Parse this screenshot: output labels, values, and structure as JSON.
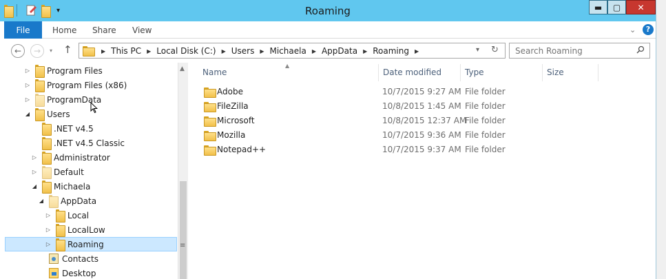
{
  "window": {
    "title": "Roaming",
    "minimize": "▬",
    "maximize": "▢",
    "close": "✕"
  },
  "ribbon": {
    "file": "File",
    "home": "Home",
    "share": "Share",
    "view": "View",
    "help": "?"
  },
  "nav": {
    "back": "←",
    "forward": "→",
    "up": "↑",
    "breadcrumbs": [
      "This PC",
      "Local Disk (C:)",
      "Users",
      "Michaela",
      "AppData",
      "Roaming"
    ],
    "search_placeholder": "Search Roaming"
  },
  "tree": [
    {
      "label": "Program Files",
      "toggle": "▷"
    },
    {
      "label": "Program Files (x86)",
      "toggle": "▷"
    },
    {
      "label": "ProgramData",
      "toggle": "▷"
    },
    {
      "label": "Users",
      "toggle": "◢"
    },
    {
      "label": ".NET v4.5",
      "toggle": ""
    },
    {
      "label": ".NET v4.5 Classic",
      "toggle": ""
    },
    {
      "label": "Administrator",
      "toggle": "▷"
    },
    {
      "label": "Default",
      "toggle": "▷"
    },
    {
      "label": "Michaela",
      "toggle": "◢"
    },
    {
      "label": "AppData",
      "toggle": "◢"
    },
    {
      "label": "Local",
      "toggle": "▷"
    },
    {
      "label": "LocalLow",
      "toggle": "▷"
    },
    {
      "label": "Roaming",
      "toggle": "▷",
      "selected": true
    },
    {
      "label": "Contacts",
      "toggle": ""
    },
    {
      "label": "Desktop",
      "toggle": ""
    }
  ],
  "columns": {
    "name": "Name",
    "date": "Date modified",
    "type": "Type",
    "size": "Size"
  },
  "files": [
    {
      "name": "Adobe",
      "date": "10/7/2015 9:27 AM",
      "type": "File folder"
    },
    {
      "name": "FileZilla",
      "date": "10/8/2015 1:45 AM",
      "type": "File folder"
    },
    {
      "name": "Microsoft",
      "date": "10/8/2015 12:37 AM",
      "type": "File folder"
    },
    {
      "name": "Mozilla",
      "date": "10/7/2015 9:36 AM",
      "type": "File folder"
    },
    {
      "name": "Notepad++",
      "date": "10/7/2015 9:37 AM",
      "type": "File folder"
    }
  ]
}
